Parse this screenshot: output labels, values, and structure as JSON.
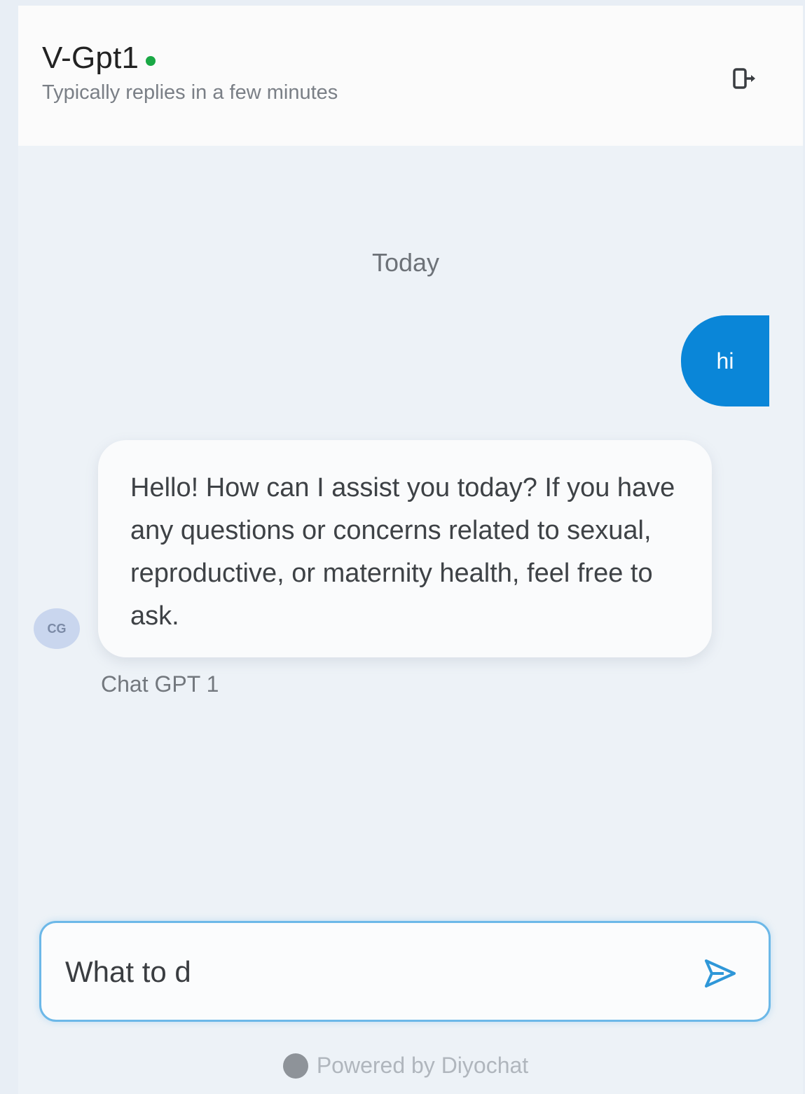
{
  "header": {
    "title": "V-Gpt1",
    "subtitle": "Typically replies in a few minutes",
    "status_color": "#1aa845",
    "exit_icon": "exit-icon"
  },
  "conversation": {
    "day_label": "Today",
    "messages": [
      {
        "sender": "user",
        "text": "hi"
      },
      {
        "sender": "bot",
        "text": "Hello! How can I assist you today? If you have any questions or concerns related to sexual, reproductive, or maternity health, feel free to ask.",
        "avatar_initials": "CG",
        "author": "Chat GPT 1"
      }
    ]
  },
  "composer": {
    "value": "What to d",
    "send_icon": "send-icon"
  },
  "footer": {
    "powered_by": "Powered by Diyochat",
    "brand_icon": "chat-bubble-icon"
  },
  "colors": {
    "accent": "#0a86d8",
    "input_border": "#6cb8e8",
    "background": "#edf2f7"
  }
}
